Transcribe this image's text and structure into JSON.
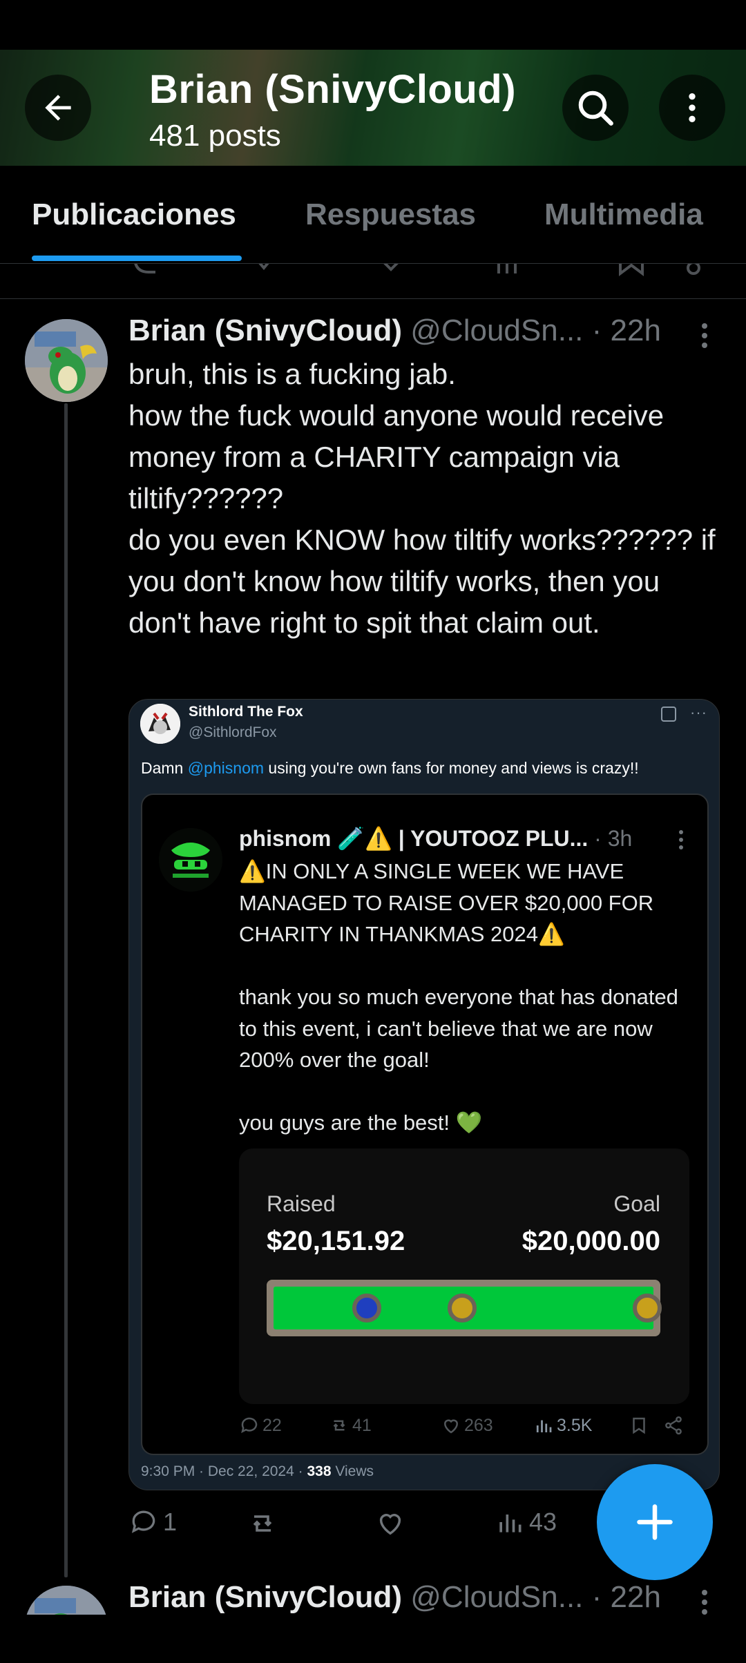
{
  "header": {
    "title": "Brian (SnivyCloud)",
    "posts_count": "481 posts"
  },
  "tabs": [
    {
      "label": "Publicaciones",
      "active": true
    },
    {
      "label": "Respuestas",
      "active": false
    },
    {
      "label": "Multimedia",
      "active": false
    }
  ],
  "post": {
    "display_name": "Brian (SnivyCloud)",
    "handle": "@CloudSn...",
    "time": "· 22h",
    "text": "bruh, this is a fucking jab.\nhow the fuck would anyone would receive money from a CHARITY campaign via tiltify??????\ndo you even KNOW how tiltify works?????? if you don't know how tiltify works, then you don't have right to spit that claim out.",
    "quote": {
      "display_name": "Sithlord The Fox",
      "handle": "@SithlordFox",
      "text_prefix": "Damn ",
      "mention": "@phisnom",
      "text_suffix": " using you're own fans for money and views is crazy!!",
      "footer_date": "9:30 PM · Dec 22, 2024 · ",
      "footer_views": "338",
      "footer_views_label": " Views",
      "inner": {
        "display_name": "phisnom 🧪⚠️ | YOUTOOZ PLU...",
        "time": "· 3h",
        "text": "⚠️IN ONLY A SINGLE WEEK WE HAVE MANAGED TO RAISE OVER $20,000 FOR CHARITY IN THANKMAS 2024⚠️\n\nthank you so much everyone that has donated to this event, i can't believe that we are now 200% over the goal!\n\nyou guys are the best! 💚",
        "tiltify": {
          "raised_label": "Raised",
          "raised_value": "$20,151.92",
          "goal_label": "Goal",
          "goal_value": "$20,000.00",
          "progress": 1.0
        },
        "actions": {
          "replies": "22",
          "reposts": "41",
          "likes": "263",
          "views": "3.5K"
        }
      }
    },
    "actions": {
      "replies": "1",
      "reposts": "",
      "likes": "",
      "views": "43"
    }
  },
  "next_post": {
    "display_name": "Brian (SnivyCloud)",
    "handle": "@CloudSn...",
    "time": "· 22h"
  },
  "colors": {
    "accent": "#1d9bf0",
    "background": "#000000",
    "secondary_text": "#71767b",
    "progress_fill": "#00c73a"
  },
  "icons": [
    "back-arrow-icon",
    "search-icon",
    "more-vertical-icon",
    "reply-icon",
    "repost-icon",
    "like-icon",
    "views-icon",
    "bookmark-icon",
    "share-icon",
    "plus-icon"
  ]
}
